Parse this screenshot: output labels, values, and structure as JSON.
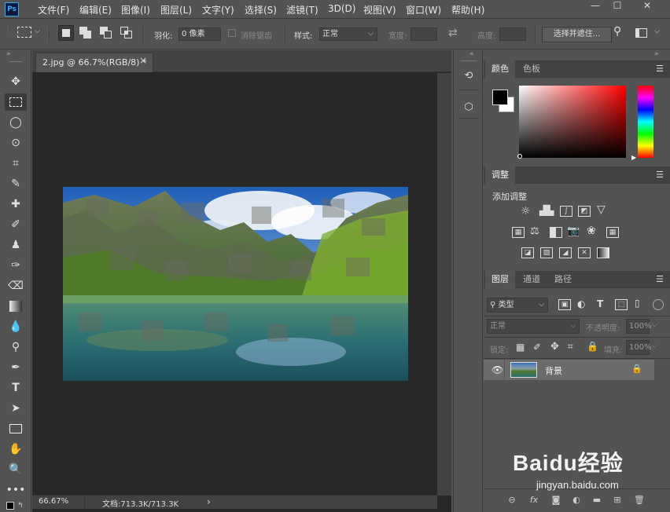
{
  "app": {
    "logo": "Ps"
  },
  "menu": [
    "文件(F)",
    "编辑(E)",
    "图像(I)",
    "图层(L)",
    "文字(Y)",
    "选择(S)",
    "滤镜(T)",
    "3D(D)",
    "视图(V)",
    "窗口(W)",
    "帮助(H)"
  ],
  "window_controls": {
    "minimize": "—",
    "maximize": "☐",
    "close": "✕"
  },
  "options": {
    "feather_label": "羽化:",
    "feather_value": "0 像素",
    "antialias_label": "消除锯齿",
    "style_label": "样式:",
    "style_value": "正常",
    "width_label": "宽度:",
    "height_label": "高度:",
    "select_mask_label": "选择并遮住..."
  },
  "document": {
    "tab_title": "2.jpg @ 66.7%(RGB/8) *",
    "tab_close": "×",
    "zoom": "66.67%",
    "doc_size": "文档:713.3K/713.3K",
    "status_arrow": "›"
  },
  "panels": {
    "color": {
      "tabs": [
        "颜色",
        "色板"
      ],
      "fg_color": "#000000",
      "bg_color": "#ffffff"
    },
    "adjustments": {
      "tab": "调整",
      "title": "添加调整"
    },
    "layers": {
      "tabs": [
        "图层",
        "通道",
        "路径"
      ],
      "filter_label": "类型",
      "blend_mode": "正常",
      "opacity_label": "不透明度:",
      "opacity_value": "100%",
      "lock_label": "锁定:",
      "fill_label": "填充:",
      "fill_value": "100%",
      "layer_name": "背景"
    }
  },
  "watermark": {
    "brand": "Baidu经验",
    "url": "jingyan.baidu.com"
  },
  "icons": {
    "move": "move-icon",
    "marquee": "rect-marquee-icon",
    "lasso": "lasso-icon",
    "quick_select": "quick-select-icon",
    "crop": "crop-icon",
    "eyedropper": "eyedropper-icon",
    "heal": "healing-brush-icon",
    "brush": "brush-icon",
    "stamp": "clone-stamp-icon",
    "history_brush": "history-brush-icon",
    "eraser": "eraser-icon",
    "gradient": "gradient-icon",
    "blur": "blur-icon",
    "dodge": "dodge-icon",
    "pen": "pen-icon",
    "type": "type-icon",
    "path_select": "path-selection-icon",
    "shape": "rectangle-shape-icon",
    "hand": "hand-icon",
    "zoom": "zoom-icon",
    "more": "more-icon"
  }
}
